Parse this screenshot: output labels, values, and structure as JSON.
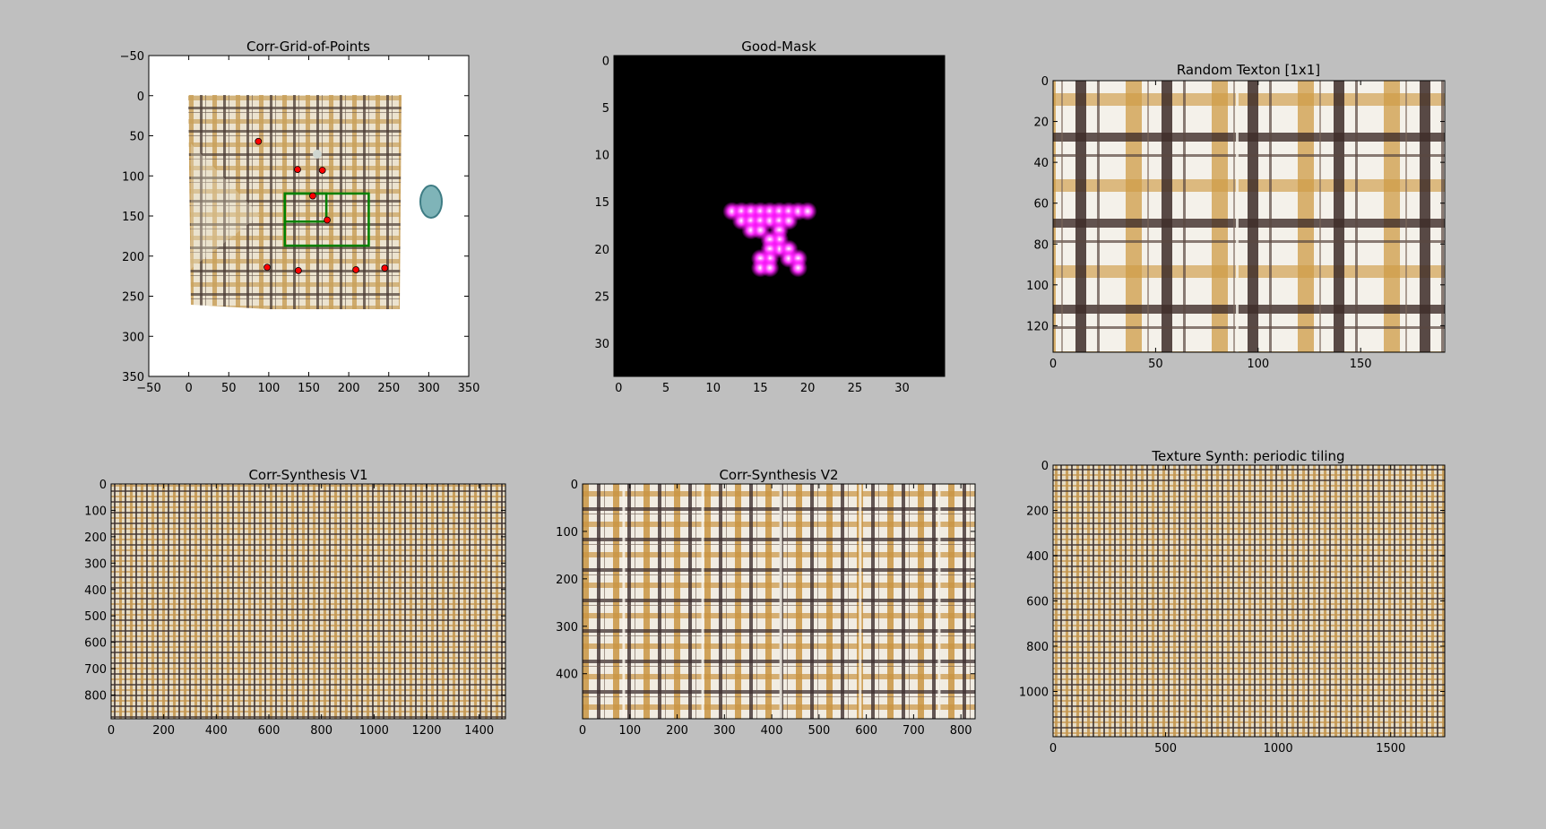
{
  "colors": {
    "figure_background": "#bfbfbf",
    "fabric_cream": "#efe7d6",
    "fabric_tan": "#c59a55",
    "fabric_brown": "#4a3a34",
    "point_red": "#ff0000",
    "box_green": "#008000",
    "mask_magenta": "#ff00ff"
  },
  "chart_data": [
    {
      "type": "image",
      "title": "Corr-Grid-of-Points",
      "xlim": [
        -50,
        350
      ],
      "ylim": [
        350,
        -50
      ],
      "xticks": [
        -50,
        0,
        50,
        100,
        150,
        200,
        250,
        300,
        350
      ],
      "yticks": [
        -50,
        0,
        50,
        100,
        150,
        200,
        250,
        300,
        350
      ],
      "image_extent": {
        "x": [
          0,
          315
        ],
        "y": [
          0,
          268
        ]
      },
      "points": [
        [
          87,
          57
        ],
        [
          136,
          92
        ],
        [
          167,
          93
        ],
        [
          155,
          125
        ],
        [
          173,
          155
        ],
        [
          98,
          214
        ],
        [
          137,
          218
        ],
        [
          209,
          217
        ],
        [
          245,
          215
        ]
      ],
      "boxes": [
        [
          120,
          122,
          225,
          187
        ],
        [
          120,
          122,
          172,
          157
        ]
      ]
    },
    {
      "type": "heatmap",
      "title": "Good-Mask",
      "xlim": [
        -0.5,
        34.5
      ],
      "ylim": [
        33.5,
        -0.5
      ],
      "xticks": [
        0,
        5,
        10,
        15,
        20,
        25,
        30
      ],
      "yticks": [
        0,
        5,
        10,
        15,
        20,
        25,
        30
      ],
      "active_pixels": [
        [
          12,
          16
        ],
        [
          13,
          16
        ],
        [
          14,
          16
        ],
        [
          15,
          16
        ],
        [
          16,
          16
        ],
        [
          17,
          16
        ],
        [
          18,
          16
        ],
        [
          19,
          16
        ],
        [
          20,
          16
        ],
        [
          13,
          17
        ],
        [
          14,
          17
        ],
        [
          15,
          17
        ],
        [
          16,
          17
        ],
        [
          17,
          17
        ],
        [
          18,
          17
        ],
        [
          14,
          18
        ],
        [
          15,
          18
        ],
        [
          17,
          18
        ],
        [
          17,
          19
        ],
        [
          16,
          19
        ],
        [
          17,
          20
        ],
        [
          16,
          20
        ],
        [
          18,
          20
        ],
        [
          16,
          21
        ],
        [
          15,
          21
        ],
        [
          18,
          21
        ],
        [
          19,
          21
        ],
        [
          15,
          22
        ],
        [
          16,
          22
        ],
        [
          19,
          22
        ]
      ]
    },
    {
      "type": "image",
      "title": "Random Texton [1x1]",
      "xlim": [
        0,
        191
      ],
      "ylim": [
        133,
        0
      ],
      "xticks": [
        0,
        50,
        100,
        150
      ],
      "yticks": [
        0,
        20,
        40,
        60,
        80,
        100,
        120
      ],
      "seams": [
        90
      ]
    },
    {
      "type": "image",
      "title": "Corr-Synthesis V1",
      "xlim": [
        0,
        1500
      ],
      "ylim": [
        890,
        0
      ],
      "xticks": [
        0,
        200,
        400,
        600,
        800,
        1000,
        1200,
        1400
      ],
      "yticks": [
        0,
        100,
        200,
        300,
        400,
        500,
        600,
        700,
        800
      ]
    },
    {
      "type": "image",
      "title": "Corr-Synthesis V2",
      "xlim": [
        0,
        830
      ],
      "ylim": [
        495,
        0
      ],
      "xticks": [
        0,
        100,
        200,
        300,
        400,
        500,
        600,
        700,
        800
      ],
      "yticks": [
        0,
        100,
        200,
        300,
        400
      ],
      "seams": [
        88,
        255,
        420,
        588,
        755
      ]
    },
    {
      "type": "image",
      "title": "Texture Synth: periodic tiling",
      "xlim": [
        0,
        1740
      ],
      "ylim": [
        1200,
        0
      ],
      "xticks": [
        0,
        500,
        1000,
        1500
      ],
      "yticks": [
        0,
        200,
        400,
        600,
        800,
        1000
      ]
    }
  ]
}
